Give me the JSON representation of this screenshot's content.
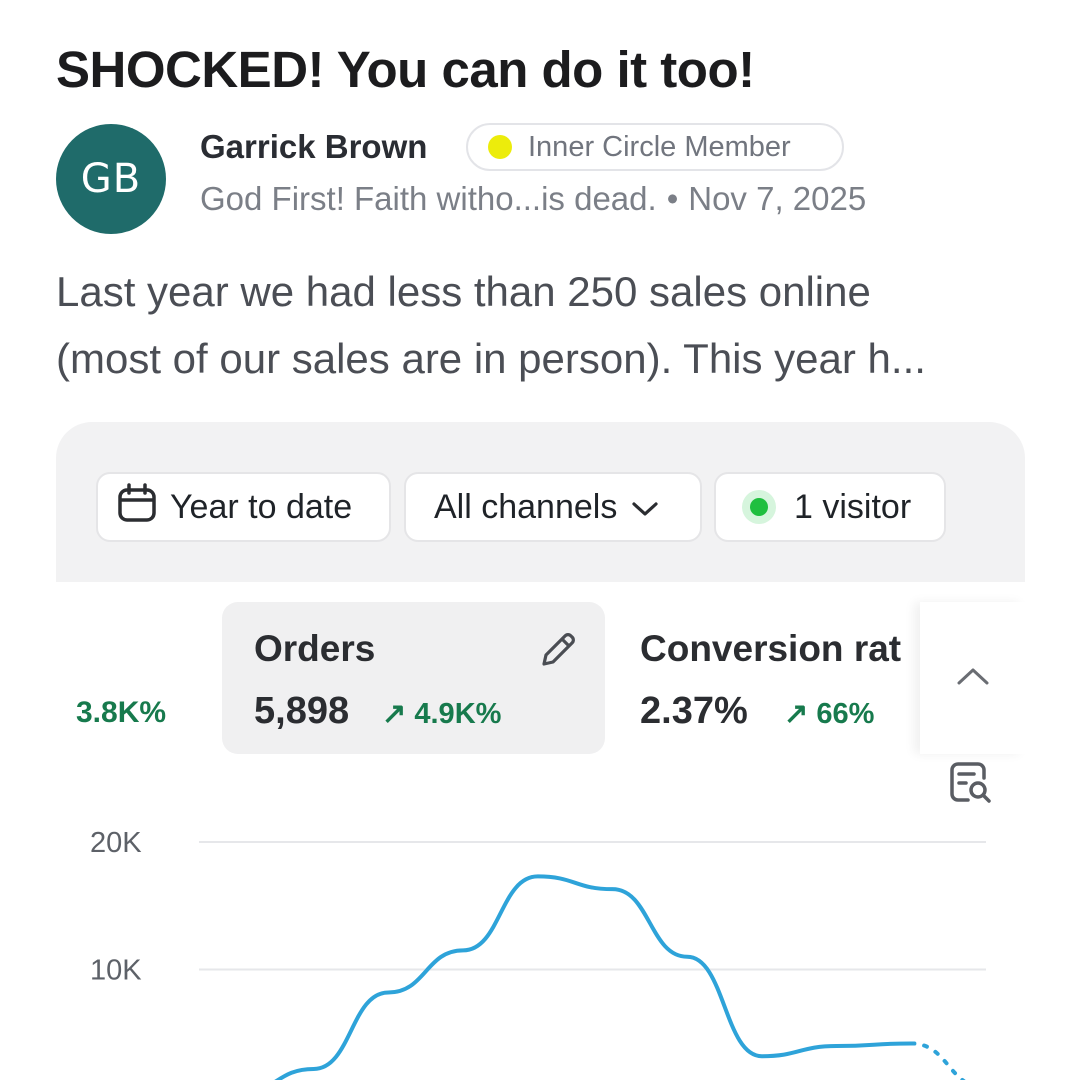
{
  "post": {
    "title": "SHOCKED! You can do it too!",
    "author": {
      "initials": "GB",
      "name": "Garrick Brown",
      "badge": "Inner Circle Member",
      "tagline": "God First! Faith witho...is dead.",
      "date": "Nov 7, 2025"
    },
    "body_lines": [
      "Last year we had less than 250 sales online",
      "(most of our sales are in person). This year h..."
    ]
  },
  "dashboard": {
    "filters": {
      "date_range": "Year to date",
      "channels": "All channels",
      "visitors": "1 visitor"
    },
    "offscreen_metric_delta": "3.8K%",
    "metrics": [
      {
        "label": "Orders",
        "value": "5,898",
        "delta": "4.9K%",
        "delta_arrow": "↗"
      },
      {
        "label": "Conversion rat",
        "value": "2.37%",
        "delta": "66%",
        "delta_arrow": "↗"
      }
    ],
    "colors": {
      "line": "#2ea3d9",
      "positive": "#177a4d",
      "live_dot": "#1fbf3f",
      "badge_dot": "#ecec0b",
      "avatar": "#1f6b6a"
    },
    "icons": [
      "calendar-icon",
      "chevron-down-icon",
      "pencil-icon",
      "chevron-up-icon",
      "search-document-icon"
    ]
  },
  "chart_data": {
    "type": "line",
    "ylabel": "",
    "xlabel": "",
    "y_tick_labels": [
      "20K",
      "10K"
    ],
    "y_ticks": [
      20000,
      10000
    ],
    "ylim": [
      0,
      20000
    ],
    "series": [
      {
        "style": "solid",
        "x": [
          0,
          1,
          2,
          3,
          4,
          5,
          6,
          7,
          8,
          9
        ],
        "y": [
          300,
          2200,
          8200,
          11500,
          17300,
          16300,
          11000,
          3200,
          4000,
          4200
        ]
      },
      {
        "style": "dotted",
        "x": [
          9,
          10
        ],
        "y": [
          4200,
          700
        ]
      }
    ],
    "grid": true
  }
}
